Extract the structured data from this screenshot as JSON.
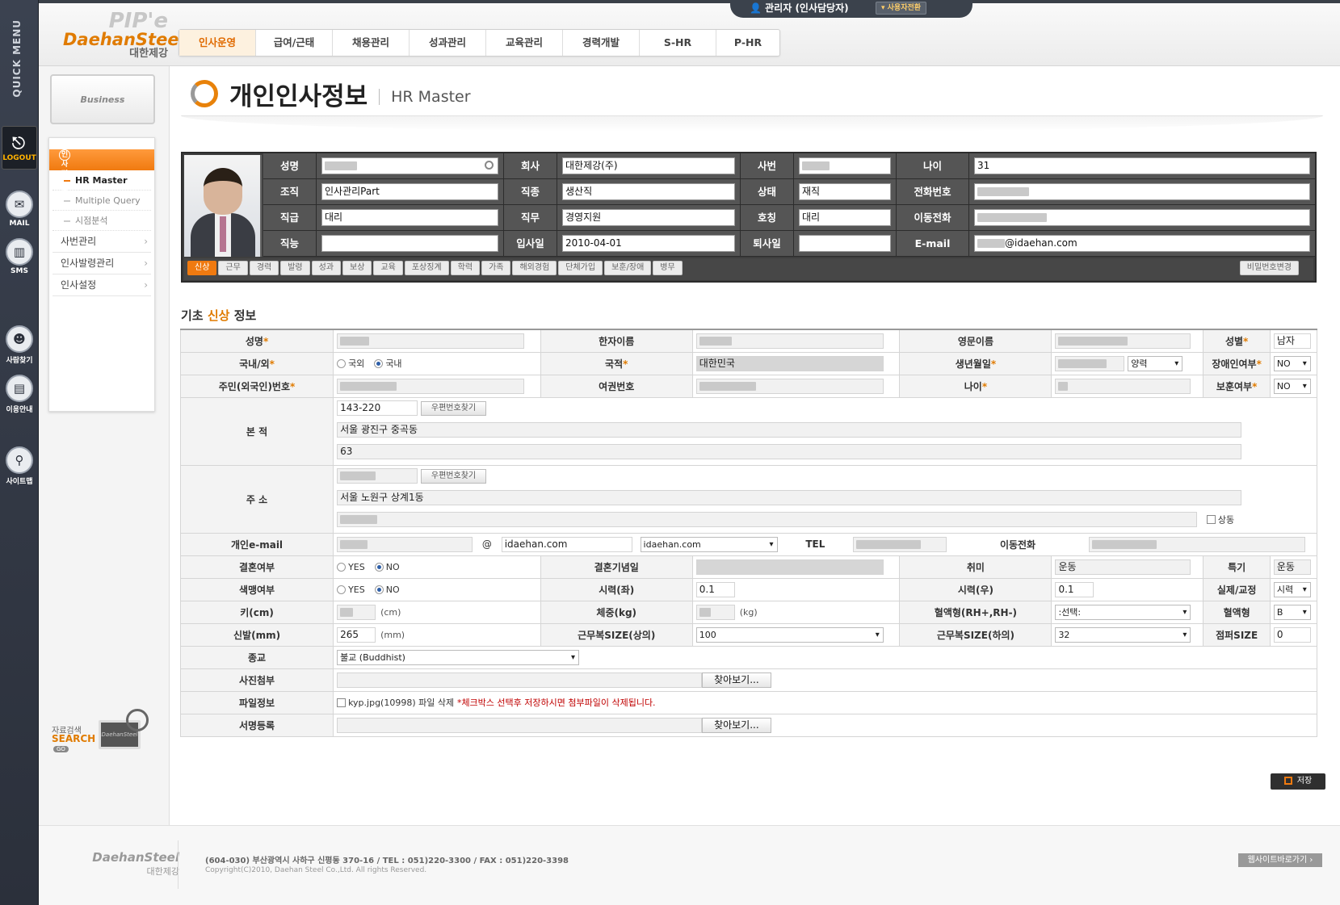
{
  "quick_menu": {
    "title": "QUICK MENU",
    "logout": "LOGOUT",
    "items": [
      {
        "label": "MAIL",
        "icon": "mail-icon"
      },
      {
        "label": "SMS",
        "icon": "sms-icon"
      },
      {
        "label": "사람찾기",
        "icon": "people-icon"
      },
      {
        "label": "이용안내",
        "icon": "book-icon"
      },
      {
        "label": "사이트맵",
        "icon": "magnifier-icon"
      }
    ]
  },
  "header": {
    "logo_top": "PIP'e",
    "logo_brand": "DaehanSteel",
    "logo_kr": "대한제강",
    "user": "관리자 (인사담당자)",
    "switch_user": "사용자전환",
    "nav": [
      "인사운영",
      "급여/근태",
      "채용관리",
      "성과관리",
      "교육관리",
      "경력개발",
      "S-HR",
      "P-HR"
    ],
    "nav_active": "인사운영"
  },
  "sidebar": {
    "business": "Business",
    "section": "인사정보관리",
    "sub_items": [
      "HR Master",
      "Multiple Query",
      "시점분석"
    ],
    "active_sub": "HR Master",
    "items": [
      "사번관리",
      "인사발령관리",
      "인사설정"
    ],
    "search_small": "자료검색",
    "search_big": "SEARCH",
    "go": "GO",
    "monitor_text": "DaehanSteel"
  },
  "page": {
    "title": "개인인사정보",
    "subtitle": "HR Master"
  },
  "profile": {
    "rows": [
      [
        {
          "label": "성명",
          "value": ""
        },
        {
          "label": "회사",
          "value": "대한제강(주)"
        },
        {
          "label": "사번",
          "value": ""
        },
        {
          "label": "나이",
          "value": "31"
        }
      ],
      [
        {
          "label": "조직",
          "value": "인사관리Part"
        },
        {
          "label": "직종",
          "value": "생산직"
        },
        {
          "label": "상태",
          "value": "재직"
        },
        {
          "label": "전화번호",
          "value": ""
        }
      ],
      [
        {
          "label": "직급",
          "value": "대리"
        },
        {
          "label": "직무",
          "value": "경영지원"
        },
        {
          "label": "호칭",
          "value": "대리"
        },
        {
          "label": "이동전화",
          "value": ""
        }
      ],
      [
        {
          "label": "직능",
          "value": ""
        },
        {
          "label": "입사일",
          "value": "2010-04-01"
        },
        {
          "label": "퇴사일",
          "value": ""
        },
        {
          "label": "E-mail",
          "value": "@idaehan.com"
        }
      ]
    ],
    "tabs": [
      "신상",
      "근무",
      "경력",
      "발령",
      "성과",
      "보상",
      "교육",
      "포상징계",
      "학력",
      "가족",
      "해외경험",
      "단체가입",
      "보훈/장애",
      "병무"
    ],
    "active_tab": "신상",
    "password_button": "비밀번호변경"
  },
  "section": {
    "title_pre": "기초",
    "title_hl": "신상",
    "title_post": "정보"
  },
  "form": {
    "name_label": "성명",
    "hanja_label": "한자이름",
    "english_label": "영문이름",
    "gender_label": "성별",
    "gender_value": "남자",
    "domestic_label": "국내/외",
    "domestic_opt1": "국외",
    "domestic_opt2": "국내",
    "nationality_label": "국적",
    "nationality_value": "대한민국",
    "birth_label": "생년월일",
    "calendar_value": "양력",
    "disabled_label": "장애인여부",
    "disabled_value": "NO",
    "resident_label": "주민(외국인)번호",
    "passport_label": "여권번호",
    "age_label": "나이",
    "veteran_label": "보훈여부",
    "veteran_value": "NO",
    "origin_label": "본 적",
    "origin_zip": "143-220",
    "zip_button": "우편번호찾기",
    "origin_addr1": "서울 광진구 중곡동",
    "origin_addr2": "63",
    "address_label": "주 소",
    "address_addr1": "서울 노원구 상계1동",
    "same_label": "상동",
    "email_label": "개인e-mail",
    "at": "@",
    "email_domain": "idaehan.com",
    "email_select": "idaehan.com",
    "tel_label": "TEL",
    "mobile_label": "이동전화",
    "married_label": "결혼여부",
    "yes": "YES",
    "no": "NO",
    "wedding_label": "결혼기념일",
    "hobby_label": "취미",
    "hobby_value": "운동",
    "skill_label": "특기",
    "skill_value": "운동",
    "colorblind_label": "색맹여부",
    "vision_left_label": "시력(좌)",
    "vision_left_value": "0.1",
    "vision_right_label": "시력(우)",
    "vision_right_value": "0.1",
    "vision_type_label": "실제/교정",
    "vision_type_value": "시력",
    "height_label": "키(cm)",
    "height_unit": "(cm)",
    "weight_label": "체중(kg)",
    "weight_unit": "(kg)",
    "blood_rh_label": "혈액형(RH+,RH-)",
    "blood_rh_value": ":선택:",
    "blood_label": "혈액형",
    "blood_value": "B",
    "shoe_label": "신발(mm)",
    "shoe_value": "265",
    "shoe_unit": "(mm)",
    "uniform_top_label": "근무복SIZE(상의)",
    "uniform_top_value": "100",
    "uniform_bottom_label": "근무복SIZE(하의)",
    "uniform_bottom_value": "32",
    "jumper_label": "점퍼SIZE",
    "jumper_value": "0",
    "religion_label": "종교",
    "religion_value": "불교 (Buddhist)",
    "photo_label": "사진첨부",
    "browse": "찾아보기...",
    "file_label": "파일정보",
    "file_name": "kyp.jpg(10998) 파일 삭제",
    "file_warning": "*체크박스 선택후 저장하시면 첨부파일이 삭제됩니다.",
    "sign_label": "서명등록"
  },
  "save_button": "저장",
  "footer": {
    "brand": "DaehanSteel",
    "kr": "대한제강",
    "address": "(604-030) 부산광역시 사하구 신평동 370-16   /   TEL : 051)220-3300   /   FAX : 051)220-3398",
    "copyright": "Copyright(C)2010, Daehan Steel Co.,Ltd. All rights Reserved.",
    "site_button": "웹사이트바로가기"
  }
}
